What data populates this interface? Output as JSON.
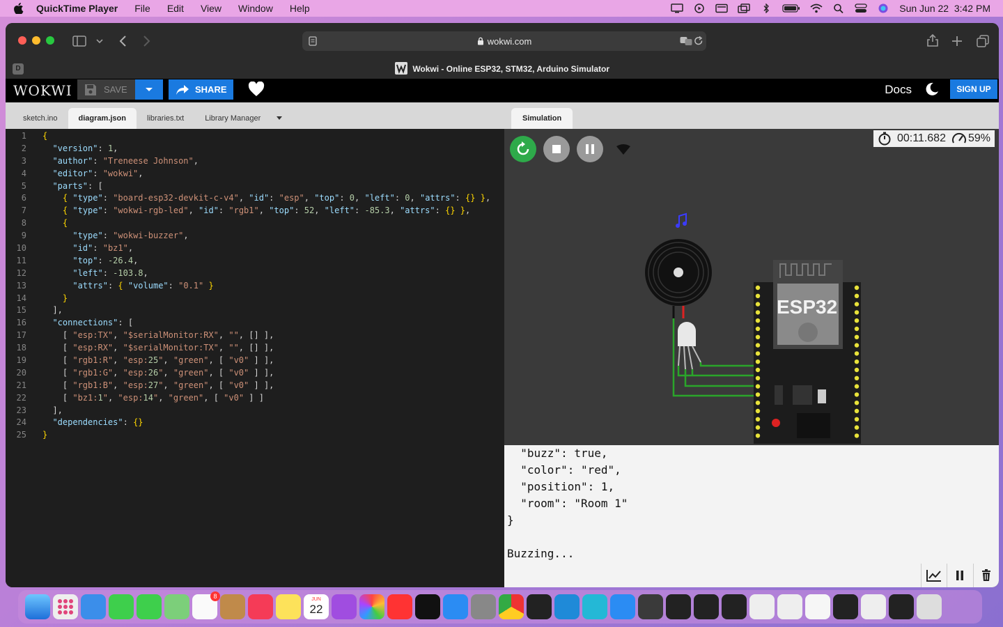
{
  "menubar": {
    "app_name": "QuickTime Player",
    "items": [
      "File",
      "Edit",
      "View",
      "Window",
      "Help"
    ],
    "clock": "Sun Jun 22  3:42 PM"
  },
  "browser": {
    "url": "wokwi.com",
    "tab_title": "Wokwi - Online ESP32, STM32, Arduino Simulator",
    "tab_badge": "D"
  },
  "toolbar": {
    "logo": "WOKWI",
    "save_label": "SAVE",
    "share_label": "SHARE",
    "docs_label": "Docs",
    "signup_label": "SIGN UP"
  },
  "editor": {
    "tabs": [
      {
        "label": "sketch.ino",
        "active": false
      },
      {
        "label": "diagram.json",
        "active": true
      },
      {
        "label": "libraries.txt",
        "active": false
      },
      {
        "label": "Library Manager",
        "active": false
      }
    ],
    "lines": [
      "{",
      "  \"version\": 1,",
      "  \"author\": \"Treneese Johnson\",",
      "  \"editor\": \"wokwi\",",
      "  \"parts\": [",
      "    { \"type\": \"board-esp32-devkit-c-v4\", \"id\": \"esp\", \"top\": 0, \"left\": 0, \"attrs\": {} },",
      "    { \"type\": \"wokwi-rgb-led\", \"id\": \"rgb1\", \"top\": 52, \"left\": -85.3, \"attrs\": {} },",
      "    {",
      "      \"type\": \"wokwi-buzzer\",",
      "      \"id\": \"bz1\",",
      "      \"top\": -26.4,",
      "      \"left\": -103.8,",
      "      \"attrs\": { \"volume\": \"0.1\" }",
      "    }",
      "  ],",
      "  \"connections\": [",
      "    [ \"esp:TX\", \"$serialMonitor:RX\", \"\", [] ],",
      "    [ \"esp:RX\", \"$serialMonitor:TX\", \"\", [] ],",
      "    [ \"rgb1:R\", \"esp:25\", \"green\", [ \"v0\" ] ],",
      "    [ \"rgb1:G\", \"esp:26\", \"green\", [ \"v0\" ] ],",
      "    [ \"rgb1:B\", \"esp:27\", \"green\", [ \"v0\" ] ],",
      "    [ \"bz1:1\", \"esp:14\", \"green\", [ \"v0\" ] ]",
      "  ],",
      "  \"dependencies\": {}",
      "}"
    ]
  },
  "simulation": {
    "tab_label": "Simulation",
    "timer": "00:11.682",
    "speed": "59%",
    "board_label": "ESP32"
  },
  "serial": {
    "lines": [
      "  \"buzz\": true,",
      "  \"color\": \"red\",",
      "  \"position\": 1,",
      "  \"room\": \"Room 1\"",
      "}",
      "",
      "Buzzing..."
    ]
  },
  "dock": {
    "calendar_month": "JUN",
    "calendar_day": "22",
    "reminders_badge": "8"
  },
  "colors": {
    "accent": "#1a7ae0",
    "menubar": "#e9a6e6",
    "run_button": "#2eaa4a"
  }
}
